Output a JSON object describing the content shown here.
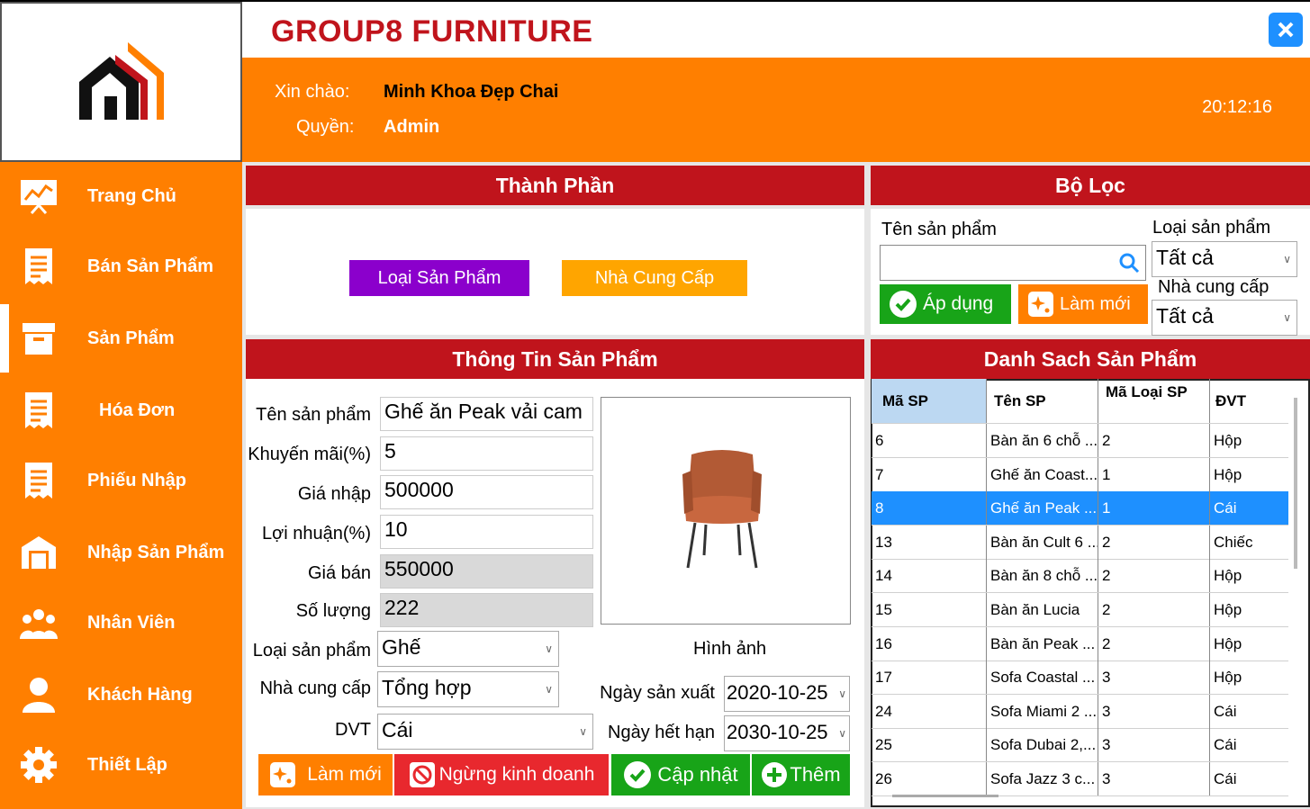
{
  "app": {
    "title": "GROUP8 FURNITURE"
  },
  "header": {
    "greeting_label": "Xin chào:",
    "user_name": "Minh Khoa Đẹp Chai",
    "role_label": "Quyền:",
    "role_value": "Admin",
    "clock": "20:12:16"
  },
  "sidebar": {
    "items": [
      {
        "label": "Trang Chủ",
        "icon": "chart-icon"
      },
      {
        "label": "Bán Sản Phẩm",
        "icon": "receipt-icon"
      },
      {
        "label": "Sản Phẩm",
        "icon": "box-icon"
      },
      {
        "label": "Hóa Đơn",
        "icon": "receipt-icon"
      },
      {
        "label": "Phiếu Nhập",
        "icon": "receipt-icon"
      },
      {
        "label": "Nhập Sản Phẩm",
        "icon": "warehouse-icon"
      },
      {
        "label": "Nhân Viên",
        "icon": "team-icon"
      },
      {
        "label": "Khách Hàng",
        "icon": "user-icon"
      },
      {
        "label": "Thiết Lập",
        "icon": "gear-icon"
      }
    ]
  },
  "components_panel": {
    "title": "Thành Phần",
    "category_button": "Loại Sản Phẩm",
    "supplier_button": "Nhà Cung Cấp"
  },
  "filter_panel": {
    "title": "Bộ Lọc",
    "name_label": "Tên sản phẩm",
    "name_value": "",
    "category_label": "Loại sản phẩm",
    "category_value": "Tất cả",
    "supplier_label": "Nhà cung cấp",
    "supplier_value": "Tất cả",
    "apply_button": "Áp dụng",
    "reset_button": "Làm mới"
  },
  "product_info": {
    "title": "Thông Tin Sản Phẩm",
    "name_label": "Tên sản phẩm",
    "name_value": "Ghế ăn Peak vải cam",
    "discount_label": "Khuyến mãi(%)",
    "discount_value": "5",
    "import_price_label": "Giá nhập",
    "import_price_value": "500000",
    "profit_label": "Lợi nhuận(%)",
    "profit_value": "10",
    "sale_price_label": "Giá bán",
    "sale_price_value": "550000",
    "quantity_label": "Số lượng",
    "quantity_value": "222",
    "category_label": "Loại sản phẩm",
    "category_value": "Ghế",
    "supplier_label": "Nhà cung cấp",
    "supplier_value": "Tổng hợp",
    "unit_label": "DVT",
    "unit_value": "Cái",
    "image_label": "Hình ảnh",
    "mfg_date_label": "Ngày sản xuất",
    "mfg_date_value": "2020-10-25",
    "exp_date_label": "Ngày hết hạn",
    "exp_date_value": "2030-10-25",
    "reset_button": "Làm mới",
    "discontinue_button": "Ngừng kinh doanh",
    "update_button": "Cập nhật",
    "add_button": "Thêm"
  },
  "product_list": {
    "title": "Danh Sach Sản Phẩm",
    "columns": [
      "Mã SP",
      "Tên SP",
      "Mã Loại SP",
      "ĐVT"
    ],
    "rows": [
      [
        "6",
        "Bàn ăn 6 chỗ ...",
        "2",
        "Hộp"
      ],
      [
        "7",
        "Ghế ăn Coast...",
        "1",
        "Hộp"
      ],
      [
        "8",
        "Ghế ăn Peak ...",
        "1",
        "Cái"
      ],
      [
        "13",
        "Bàn ăn Cult 6 ...",
        "2",
        "Chiếc"
      ],
      [
        "14",
        "Bàn ăn 8 chỗ ...",
        "2",
        "Hộp"
      ],
      [
        "15",
        "Bàn ăn Lucia",
        "2",
        "Hộp"
      ],
      [
        "16",
        "Bàn ăn Peak ...",
        "2",
        "Hộp"
      ],
      [
        "17",
        "Sofa Coastal ...",
        "3",
        "Hộp"
      ],
      [
        "24",
        "Sofa Miami 2 ...",
        "3",
        "Cái"
      ],
      [
        "25",
        "Sofa Dubai 2,...",
        "3",
        "Cái"
      ],
      [
        "26",
        "Sofa Jazz 3 c...",
        "3",
        "Cái"
      ]
    ],
    "selected_index": 2
  },
  "colors": {
    "orange": "#ff7f00",
    "red": "#c0141c",
    "purple": "#8b00cc",
    "green": "#18a418",
    "blue": "#1e90ff"
  }
}
